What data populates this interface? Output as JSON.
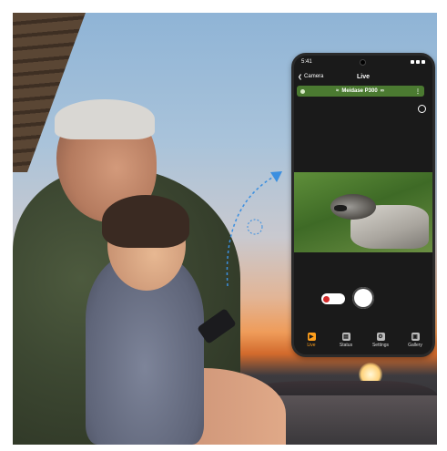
{
  "phone": {
    "status_time": "5:41",
    "nav": {
      "back_label": "Camera",
      "title": "Live"
    },
    "device": {
      "name": "Meidase P300"
    },
    "tabs": [
      {
        "label": "Live",
        "icon": "play-icon",
        "active": true
      },
      {
        "label": "Status",
        "icon": "status-icon",
        "active": false
      },
      {
        "label": "Settings",
        "icon": "gear-icon",
        "active": false
      },
      {
        "label": "Gallery",
        "icon": "gallery-icon",
        "active": false
      }
    ]
  },
  "colors": {
    "accent_orange": "#ff9f1c",
    "device_bar_green": "#4b7a31",
    "arrow_blue": "#3b8fe0",
    "record_red": "#d42a2a"
  }
}
